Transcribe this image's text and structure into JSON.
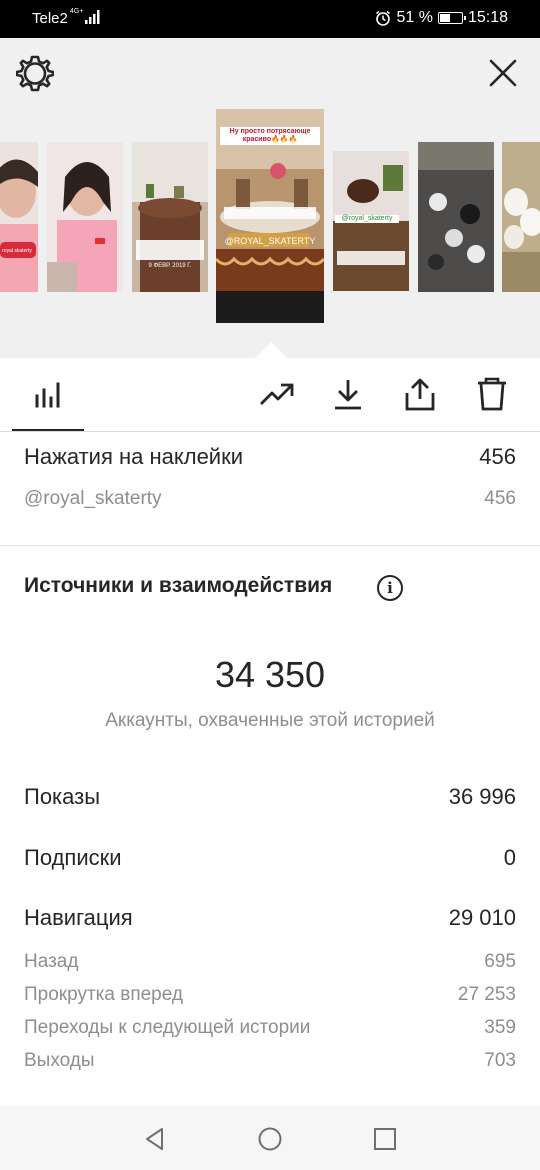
{
  "status_bar": {
    "carrier": "Tele2",
    "network": "4G+",
    "battery": "51 %",
    "time": "15:18",
    "battery_level": 0.51
  },
  "header": {
    "settings_icon": "gear-icon",
    "close_icon": "close-icon"
  },
  "stories": {
    "selected_caption": "Ну просто потрясающе красиво🔥🔥🔥",
    "selected_mention": "@ROYAL_SKATERTY",
    "mention_2": "@royal_skaterty",
    "thumb1_tag": "royal skaterty",
    "thumb3_caption": "9 ФЕВР. 2019 Г."
  },
  "tabs": {
    "stats_icon": "bar-chart-icon",
    "promote_icon": "trending-up-icon",
    "download_icon": "download-icon",
    "share_icon": "share-icon",
    "delete_icon": "trash-icon"
  },
  "sticker_taps": {
    "label": "Нажатия на наклейки",
    "value": "456",
    "items": [
      {
        "label": "@royal_skaterty",
        "value": "456"
      }
    ]
  },
  "interactions": {
    "title": "Источники и взаимодействия",
    "info_icon": "info-icon",
    "reach_value": "34 350",
    "reach_label": "Аккаунты, охваченные этой историей",
    "impressions_label": "Показы",
    "impressions_value": "36 996",
    "follows_label": "Подписки",
    "follows_value": "0",
    "navigation_label": "Навигация",
    "navigation_value": "29 010",
    "navigation_items": [
      {
        "label": "Назад",
        "value": "695"
      },
      {
        "label": "Прокрутка вперед",
        "value": "27 253"
      },
      {
        "label": "Переходы к следующей истории",
        "value": "359"
      },
      {
        "label": "Выходы",
        "value": "703"
      }
    ]
  },
  "system_nav": {
    "back_icon": "back-triangle-icon",
    "home_icon": "home-circle-icon",
    "recents_icon": "recents-square-icon"
  }
}
